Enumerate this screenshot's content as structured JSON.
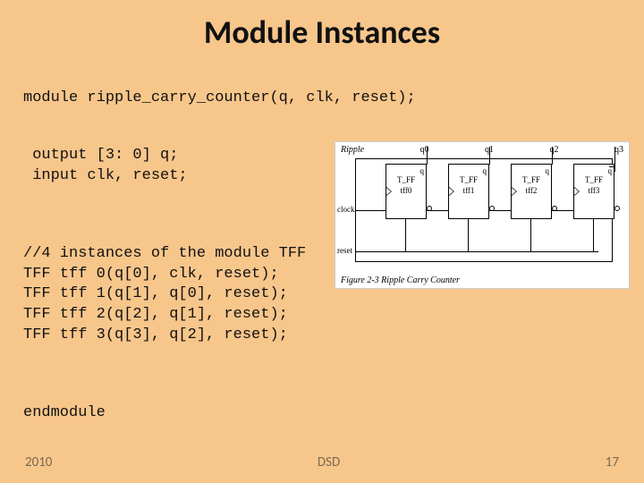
{
  "title": "Module Instances",
  "code": {
    "line1": "module ripple_carry_counter(q, clk, reset);",
    "decl1": " output [3: 0] q;",
    "decl2": " input clk, reset;",
    "c0": "//4 instances of the module TFF",
    "c1": "TFF tff 0(q[0], clk, reset);",
    "c2": "TFF tff 1(q[1], q[0], reset);",
    "c3": "TFF tff 2(q[2], q[1], reset);",
    "c4": "TFF tff 3(q[3], q[2], reset);",
    "end": "endmodule"
  },
  "diagram": {
    "module_label": "Ripple",
    "q_labels": [
      "q0",
      "q1",
      "q2",
      "q3"
    ],
    "tff_label": "T_FF",
    "inst_labels": [
      "tff0",
      "tff1",
      "tff2",
      "tff3"
    ],
    "q_port": "q",
    "clock_label": "clock",
    "reset_label": "reset",
    "caption": "Figure 2-3   Ripple Carry Counter"
  },
  "footer": {
    "left": "2010",
    "center": "DSD",
    "right": "17"
  }
}
